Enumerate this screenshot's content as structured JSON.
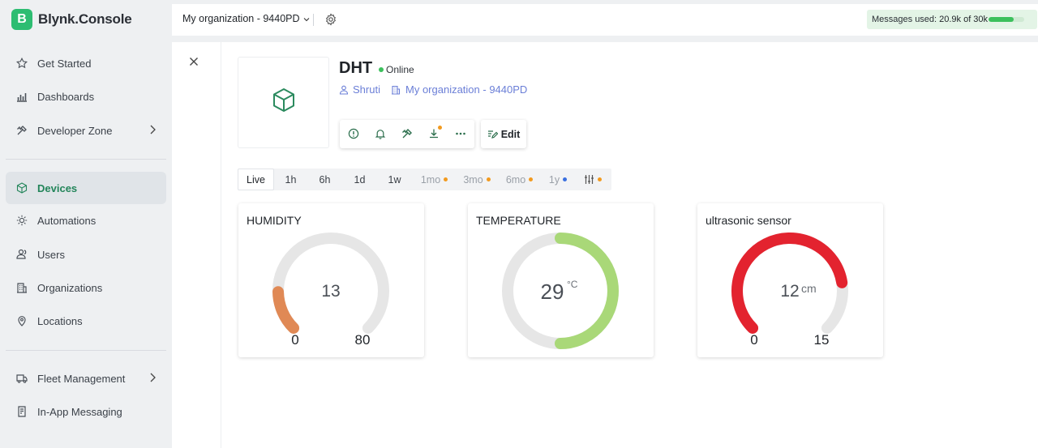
{
  "app": {
    "logo_letter": "B",
    "name": "Blynk.Console"
  },
  "sidebar": {
    "items": [
      {
        "label": "Get Started",
        "icon": "star-icon"
      },
      {
        "label": "Dashboards",
        "icon": "bar-chart-icon"
      },
      {
        "label": "Developer Zone",
        "icon": "tools-icon"
      },
      {
        "label": "Devices",
        "icon": "cube-icon"
      },
      {
        "label": "Automations",
        "icon": "sun-icon"
      },
      {
        "label": "Users",
        "icon": "users-icon"
      },
      {
        "label": "Organizations",
        "icon": "building-icon"
      },
      {
        "label": "Locations",
        "icon": "pin-icon"
      },
      {
        "label": "Fleet Management",
        "icon": "truck-icon"
      },
      {
        "label": "In-App Messaging",
        "icon": "message-icon"
      }
    ]
  },
  "topbar": {
    "organization": "My organization - 9440PD",
    "messages_label": "Messages used:",
    "messages_value": "20.9k of 30k",
    "messages_fraction": 0.7
  },
  "device": {
    "name": "DHT",
    "status": "Online",
    "owner": "Shruti",
    "organization": "My organization - 9440PD",
    "edit_label": "Edit"
  },
  "time_tabs": [
    {
      "label": "Live",
      "state": "active"
    },
    {
      "label": "1h",
      "state": "normal"
    },
    {
      "label": "6h",
      "state": "normal"
    },
    {
      "label": "1d",
      "state": "normal"
    },
    {
      "label": "1w",
      "state": "normal"
    },
    {
      "label": "1mo",
      "state": "muted",
      "dot": "#f29a1f"
    },
    {
      "label": "3mo",
      "state": "muted",
      "dot": "#f29a1f"
    },
    {
      "label": "6mo",
      "state": "muted",
      "dot": "#f29a1f"
    },
    {
      "label": "1y",
      "state": "muted",
      "dot": "#3a6fe0"
    },
    {
      "label": "",
      "state": "muted",
      "dot": "#f29a1f"
    }
  ],
  "widgets": [
    {
      "title": "HUMIDITY",
      "type": "gauge",
      "value": 13,
      "unit": "",
      "min": 0,
      "max": 80,
      "min_label": "0",
      "max_label": "80",
      "color": "#e08955"
    },
    {
      "title": "TEMPERATURE",
      "type": "ring",
      "value": 29,
      "unit": "°C",
      "fraction": 0.5,
      "color": "#a9d878"
    },
    {
      "title": "ultrasonic sensor",
      "type": "gauge",
      "value": 12,
      "unit": "cm",
      "min": 0,
      "max": 15,
      "min_label": "0",
      "max_label": "15",
      "color": "#e3232f"
    }
  ]
}
